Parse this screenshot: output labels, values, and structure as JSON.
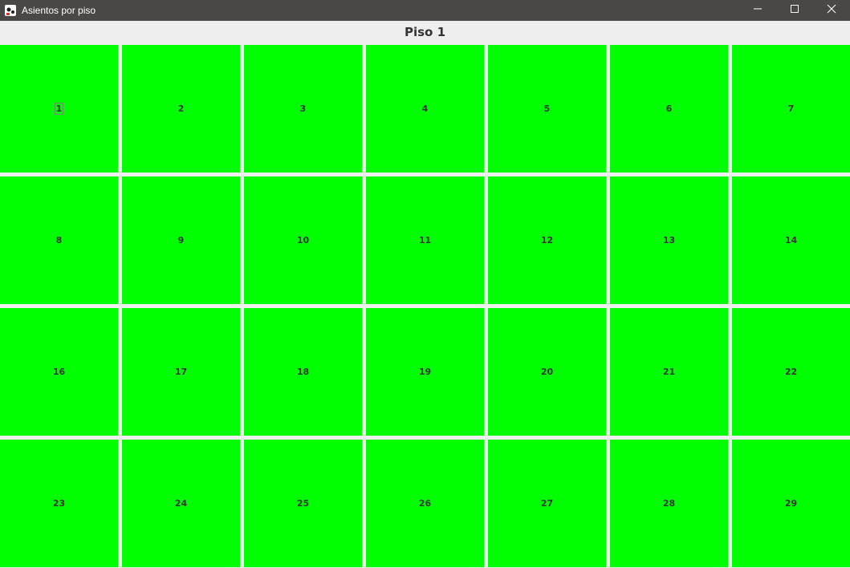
{
  "window": {
    "title": "Asientos por piso",
    "icon": "app-icon",
    "controls": [
      "minimize-icon",
      "maximize-icon",
      "close-icon"
    ]
  },
  "header": {
    "title": "Piso 1"
  },
  "colors": {
    "available_seat": "#00ff00",
    "titlebar": "#4a4846",
    "background": "#eeeeee"
  },
  "seats": [
    {
      "label": "1",
      "focused": true
    },
    {
      "label": "2"
    },
    {
      "label": "3"
    },
    {
      "label": "4"
    },
    {
      "label": "5"
    },
    {
      "label": "6"
    },
    {
      "label": "7"
    },
    {
      "label": "8"
    },
    {
      "label": "9"
    },
    {
      "label": "10"
    },
    {
      "label": "11"
    },
    {
      "label": "12"
    },
    {
      "label": "13"
    },
    {
      "label": "14"
    },
    {
      "label": "16"
    },
    {
      "label": "17"
    },
    {
      "label": "18"
    },
    {
      "label": "19"
    },
    {
      "label": "20"
    },
    {
      "label": "21"
    },
    {
      "label": "22"
    },
    {
      "label": "23"
    },
    {
      "label": "24"
    },
    {
      "label": "25"
    },
    {
      "label": "26"
    },
    {
      "label": "27"
    },
    {
      "label": "28"
    },
    {
      "label": "29"
    }
  ]
}
